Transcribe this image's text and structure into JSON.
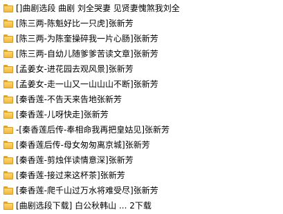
{
  "files": [
    {
      "name": "[]曲剧选段 曲剧 刘全哭妻 见贤妻愧煞我刘全"
    },
    {
      "name": "[陈三两-陈魁好比一只虎]张新芳"
    },
    {
      "name": "[陈三两-为陈奎操碎我一片心肠]张新芳"
    },
    {
      "name": "[陈三两-自幼儿随爹爹苦读文章]张新芳"
    },
    {
      "name": "[孟姜女-进花园去观风景]张新芳"
    },
    {
      "name": "[孟姜女-走一山又一山山山不断]张新芳"
    },
    {
      "name": "[秦香莲-不告天来告地张新芳"
    },
    {
      "name": "[秦香莲-儿呀快走]张新芳"
    },
    {
      "name": "-[秦香莲后传-奉相命我再把皇姑见]张新芳"
    },
    {
      "name": "[秦香莲后传-母女匆匆离京城]张新芳"
    },
    {
      "name": "[秦香莲-剪烛伴读情意深]张新芳"
    },
    {
      "name": "[秦香莲-接过来这杯茶]张新芳"
    },
    {
      "name": "[秦香莲-爬千山过万水将难受尽]张新芳"
    },
    {
      "name": "[曲剧选段下载] 白公秋韩山 ... 2下载"
    }
  ]
}
